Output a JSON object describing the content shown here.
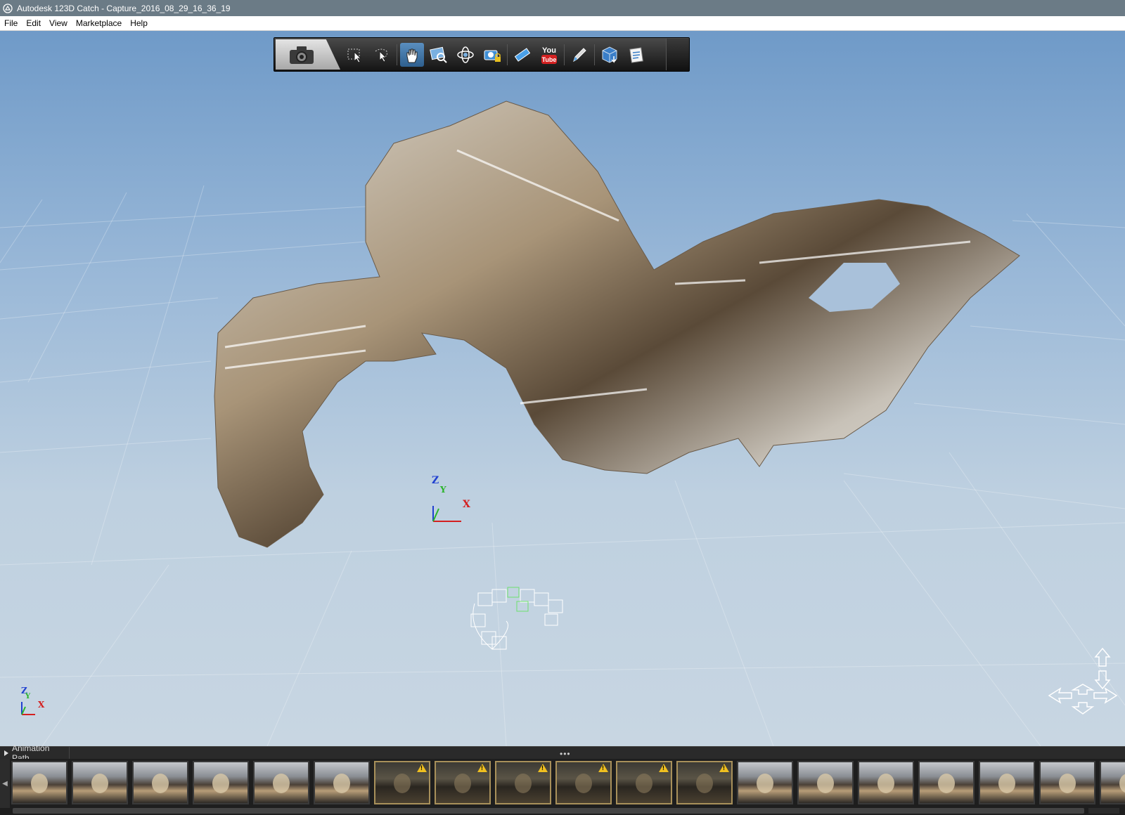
{
  "window": {
    "title": "Autodesk 123D Catch - Capture_2016_08_29_16_36_19"
  },
  "menu": [
    "File",
    "Edit",
    "View",
    "Marketplace",
    "Help"
  ],
  "toolbar": {
    "camera_icon": "camera-icon",
    "tools": [
      {
        "icon": "select-icon",
        "active": false
      },
      {
        "icon": "lasso-select-icon",
        "active": false
      },
      {
        "icon": "pan-hand-icon",
        "active": true
      },
      {
        "icon": "zoom-window-icon",
        "active": false
      },
      {
        "icon": "orbit-icon",
        "active": false
      },
      {
        "icon": "locked-camera-icon",
        "active": false
      },
      {
        "icon": "ruler-icon",
        "active": false
      },
      {
        "icon": "youtube-icon",
        "active": false,
        "label_top": "You",
        "label_bottom": "Tube"
      },
      {
        "icon": "pen-icon",
        "active": false
      },
      {
        "icon": "mesh-export-icon",
        "active": false
      },
      {
        "icon": "notes-icon",
        "active": false
      }
    ]
  },
  "axes": {
    "center": {
      "z": "Z",
      "y": "Y",
      "x": "X"
    },
    "corner": {
      "z": "Z",
      "y": "Y",
      "x": "X"
    },
    "colors": {
      "x": "#d42020",
      "y": "#2ab42a",
      "z": "#2040d0"
    }
  },
  "filmstrip": {
    "header_label": "Animation Path",
    "grip": "•••",
    "thumbnails": [
      {
        "warning": false
      },
      {
        "warning": false
      },
      {
        "warning": false
      },
      {
        "warning": false
      },
      {
        "warning": false
      },
      {
        "warning": false
      },
      {
        "warning": true
      },
      {
        "warning": true
      },
      {
        "warning": true
      },
      {
        "warning": true
      },
      {
        "warning": true
      },
      {
        "warning": true
      },
      {
        "warning": false
      },
      {
        "warning": false
      },
      {
        "warning": false
      },
      {
        "warning": false
      },
      {
        "warning": false
      },
      {
        "warning": false
      },
      {
        "warning": false
      }
    ]
  }
}
